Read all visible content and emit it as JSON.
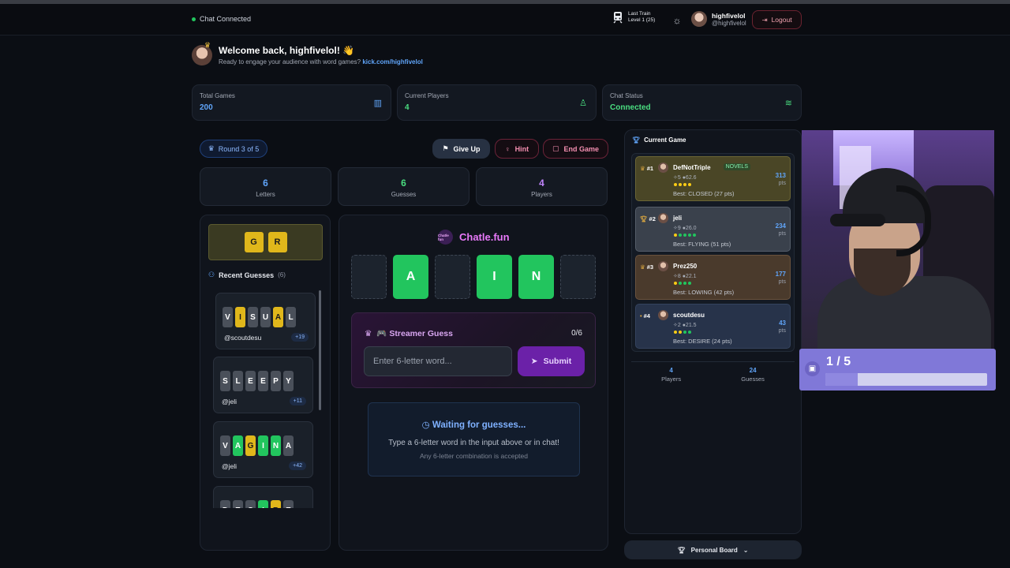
{
  "header": {
    "chat_status": "Chat Connected",
    "train_line1": "Last Train",
    "train_line2": "Level 1 (25)",
    "username": "highfivelol",
    "handle": "@highfivelol",
    "logout": "Logout"
  },
  "welcome": {
    "title": "Welcome back, highfivelol! 👋",
    "sub": "Ready to engage your audience with word games?",
    "link": "kick.com/highfivelol"
  },
  "stats": [
    {
      "label": "Total Games",
      "value": "200",
      "color": "#60a5fa",
      "icon": "bar-chart-icon"
    },
    {
      "label": "Current Players",
      "value": "4",
      "color": "#4ade80",
      "icon": "user-icon"
    },
    {
      "label": "Chat Status",
      "value": "Connected",
      "color": "#4ade80",
      "icon": "wifi-icon"
    }
  ],
  "game": {
    "round": "Round 3 of 5",
    "give_up": "Give Up",
    "hint": "Hint",
    "end_game": "End Game",
    "letters": {
      "value": "6",
      "label": "Letters"
    },
    "guesses": {
      "value": "6",
      "label": "Guesses"
    },
    "players": {
      "value": "4",
      "label": "Players"
    },
    "known_letters": [
      "G",
      "R"
    ],
    "recent_title": "Recent Guesses",
    "recent_count": "(6)",
    "recent": [
      {
        "word": [
          "V",
          "I",
          "S",
          "U",
          "A",
          "L"
        ],
        "colors": [
          "n",
          "y",
          "n",
          "n",
          "y",
          "n"
        ],
        "user": "@scoutdesu",
        "pts": "+19"
      },
      {
        "word": [
          "S",
          "L",
          "E",
          "E",
          "P",
          "Y"
        ],
        "colors": [
          "n",
          "n",
          "n",
          "n",
          "n",
          "n"
        ],
        "user": "@jeli",
        "pts": "+11"
      },
      {
        "word": [
          "V",
          "A",
          "G",
          "I",
          "N",
          "A"
        ],
        "colors": [
          "n",
          "g",
          "y",
          "g",
          "g",
          "n"
        ],
        "user": "@jeli",
        "pts": "+42"
      },
      {
        "word": [
          "D",
          "E",
          "S",
          "I",
          "R",
          "E"
        ],
        "colors": [
          "n",
          "n",
          "n",
          "g",
          "y",
          "n"
        ],
        "user": "",
        "pts": ""
      }
    ],
    "brand": "Chatle.fun",
    "brand_logo": "Chatle fun",
    "board": [
      "",
      "A",
      "",
      "I",
      "N",
      ""
    ],
    "streamer_title": "🎮 Streamer Guess",
    "streamer_count": "0/6",
    "input_placeholder": "Enter 6-letter word...",
    "submit": "Submit",
    "waiting_title": "Waiting for guesses...",
    "waiting_line": "Type a 6-letter word in the input above or in chat!",
    "waiting_note": "Any 6-letter combination is accepted"
  },
  "current_game": {
    "title": "Current Game",
    "leaderboard": [
      {
        "rank": "#1",
        "name": "DefNotTriple",
        "tag": "NOVELS",
        "stats": "✧5 ●62.6",
        "dots": [
          "#facc15",
          "#facc15",
          "#facc15",
          "#facc15"
        ],
        "best": "Best: CLOSED (27 pts)",
        "pts": "313",
        "bg": "#4a4626",
        "border": "#6b6535"
      },
      {
        "rank": "#2",
        "name": "jeli",
        "tag": "",
        "stats": "✧9 ●26.0",
        "dots": [
          "#facc15",
          "#22c55e",
          "#22c55e",
          "#22c55e",
          "#22c55e"
        ],
        "best": "Best: FLYING (51 pts)",
        "pts": "234",
        "bg": "#3a414c",
        "border": "#555d69"
      },
      {
        "rank": "#3",
        "name": "Prez250",
        "tag": "",
        "stats": "✧8 ●22.1",
        "dots": [
          "#facc15",
          "#22c55e",
          "#22c55e",
          "#22c55e"
        ],
        "best": "Best: LOWING (42 pts)",
        "pts": "177",
        "bg": "#4a3a2c",
        "border": "#6a523d"
      },
      {
        "rank": "#4",
        "name": "scoutdesu",
        "tag": "",
        "stats": "✧2 ●21.5",
        "dots": [
          "#facc15",
          "#facc15",
          "#22c55e",
          "#22c55e"
        ],
        "best": "Best: DESIRE (24 pts)",
        "pts": "43",
        "bg": "#27334a",
        "border": "#34435e"
      }
    ],
    "pts_label": "pts",
    "footer": [
      {
        "value": "4",
        "label": "Players"
      },
      {
        "value": "24",
        "label": "Guesses"
      }
    ],
    "personal_board": "Personal Board"
  },
  "overlay": {
    "count": "1 / 5",
    "progress": 0.2
  }
}
